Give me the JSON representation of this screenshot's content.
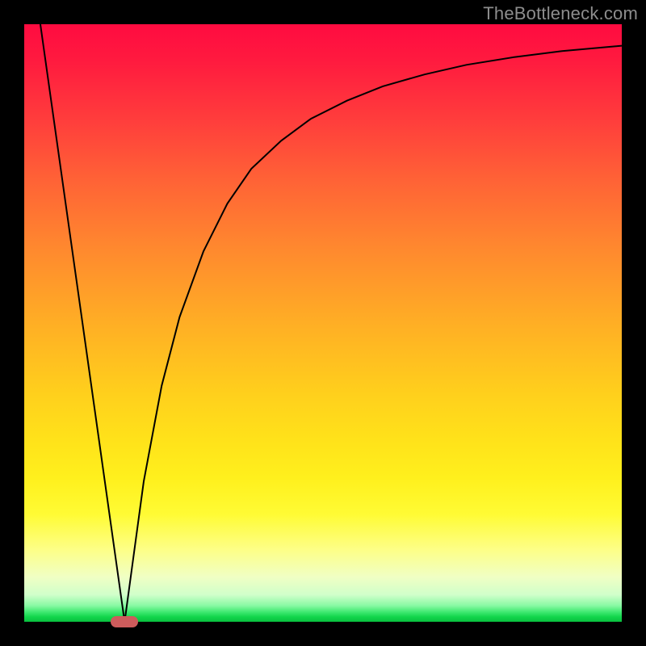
{
  "watermark": "TheBottleneck.com",
  "marker": {
    "x_fraction": 0.168,
    "width_fraction": 0.046,
    "color": "#cd5c5c"
  },
  "chart_data": {
    "type": "line",
    "title": "",
    "xlabel": "",
    "ylabel": "",
    "xlim": [
      0,
      1
    ],
    "ylim": [
      0,
      1
    ],
    "grid": false,
    "legend": false,
    "series": [
      {
        "name": "left-line",
        "x": [
          0.027,
          0.168
        ],
        "y": [
          1.0,
          0.0
        ]
      },
      {
        "name": "right-curve",
        "x": [
          0.168,
          0.2,
          0.23,
          0.26,
          0.3,
          0.34,
          0.38,
          0.43,
          0.48,
          0.54,
          0.6,
          0.67,
          0.74,
          0.82,
          0.9,
          1.0
        ],
        "y": [
          0.0,
          0.235,
          0.395,
          0.51,
          0.62,
          0.7,
          0.758,
          0.805,
          0.842,
          0.872,
          0.896,
          0.916,
          0.932,
          0.945,
          0.955,
          0.964
        ]
      }
    ],
    "annotations": [
      {
        "text": "TheBottleneck.com",
        "position": "top-right"
      }
    ]
  }
}
